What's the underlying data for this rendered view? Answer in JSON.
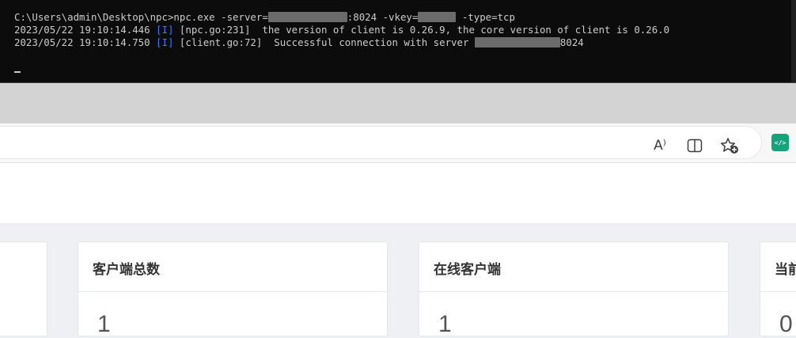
{
  "terminal": {
    "prompt": "C:\\Users\\admin\\Desktop\\npc>",
    "command": "npc.exe",
    "server_flag": "-server=",
    "server_port": ":8024",
    "vkey_flag": "-vkey=",
    "type_flag": "-type=tcp",
    "lines": [
      {
        "timestamp": "2023/05/22 19:10:14.446",
        "level": "[I]",
        "source": "[npc.go:231]",
        "message": "the version of client is 0.26.9, the core version of client is 0.26.0"
      },
      {
        "timestamp": "2023/05/22 19:10:14.750",
        "level": "[I]",
        "source": "[client.go:72]",
        "message": "Successful connection with server",
        "port": "8024"
      }
    ]
  },
  "browser": {
    "toolbar_icons": [
      "read-aloud-icon",
      "split-screen-icon",
      "add-favorite-icon",
      "extension-icon"
    ],
    "read_aloud_glyph": "A⁾",
    "extension_label": "</>"
  },
  "dashboard": {
    "cards": [
      {
        "title": "",
        "value": ""
      },
      {
        "title": "客户端总数",
        "value": "1"
      },
      {
        "title": "在线客户端",
        "value": "1"
      },
      {
        "title": "当前",
        "value": "0"
      }
    ]
  }
}
